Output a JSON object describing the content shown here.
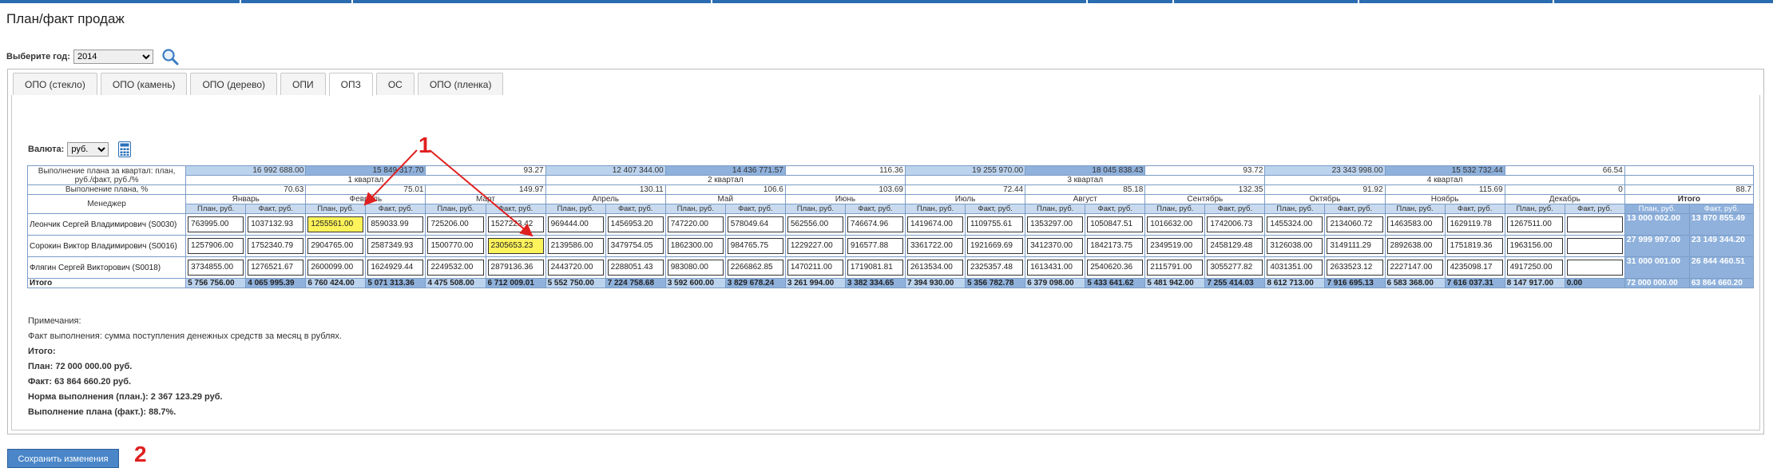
{
  "page": {
    "title": "План/факт продаж"
  },
  "filter": {
    "year_label": "Выберите год:",
    "year_value": "2014"
  },
  "tabs": [
    "ОПО (стекло)",
    "ОПО (камень)",
    "ОПО (дерево)",
    "ОПИ",
    "ОПЗ",
    "ОС",
    "ОПО (пленка)"
  ],
  "active_tab": 4,
  "currency": {
    "label": "Валюта:",
    "value": "руб."
  },
  "table": {
    "quarter_label": "Выполнение плана за квартал: план, руб./факт, руб./%",
    "quarters": [
      {
        "name": "1 квартал",
        "plan": "16 992 688.00",
        "fact": "15 849 317.70",
        "pct": "93.27"
      },
      {
        "name": "2 квартал",
        "plan": "12 407 344.00",
        "fact": "14 436 771.57",
        "pct": "116.36"
      },
      {
        "name": "3 квартал",
        "plan": "19 255 970.00",
        "fact": "18 045 838.43",
        "pct": "93.72"
      },
      {
        "name": "4 квартал",
        "plan": "23 343 998.00",
        "fact": "15 532 732.44",
        "pct": "66.54"
      }
    ],
    "pct_label": "Выполнение плана, %",
    "month_pct": [
      "70.63",
      "75.01",
      "149.97",
      "130.11",
      "106.6",
      "103.69",
      "72.44",
      "85.18",
      "132.35",
      "91.92",
      "115.69",
      "0"
    ],
    "total_pct": "88.7",
    "manager_header": "Менеджер",
    "months": [
      "Январь",
      "Февраль",
      "Март",
      "Апрель",
      "Май",
      "Июнь",
      "Июль",
      "Август",
      "Сентябрь",
      "Октябрь",
      "Ноябрь",
      "Декабрь"
    ],
    "total_header": "Итого",
    "plan_sub": "План, руб.",
    "fact_sub": "Факт, руб.",
    "rows": [
      {
        "manager": "Леончик Сергей Владимирович (S0030)",
        "cells": [
          "763995.00",
          "1037132.93",
          "1255561.00",
          "859033.99",
          "725206.00",
          "1527223.42",
          "969444.00",
          "1456953.20",
          "747220.00",
          "578049.64",
          "562556.00",
          "746674.96",
          "1419674.00",
          "1109755.61",
          "1353297.00",
          "1050847.51",
          "1016632.00",
          "1742006.73",
          "1455324.00",
          "2134060.72",
          "1463583.00",
          "1629119.78",
          "1267511.00",
          ""
        ],
        "total_plan": "13 000 002.00",
        "total_fact": "13 870 855.49"
      },
      {
        "manager": "Сорокин Виктор Владимирович (S0016)",
        "cells": [
          "1257906.00",
          "1752340.79",
          "2904765.00",
          "2587349.93",
          "1500770.00",
          "2305653.23",
          "2139586.00",
          "3479754.05",
          "1862300.00",
          "984765.75",
          "1229227.00",
          "916577.88",
          "3361722.00",
          "1921669.69",
          "3412370.00",
          "1842173.75",
          "2349519.00",
          "2458129.48",
          "3126038.00",
          "3149111.29",
          "2892638.00",
          "1751819.36",
          "1963156.00",
          ""
        ],
        "total_plan": "27 999 997.00",
        "total_fact": "23 149 344.20"
      },
      {
        "manager": "Флягин Сергей Викторович (S0018)",
        "cells": [
          "3734855.00",
          "1276521.67",
          "2600099.00",
          "1624929.44",
          "2249532.00",
          "2879136.36",
          "2443720.00",
          "2288051.43",
          "983080.00",
          "2266862.85",
          "1470211.00",
          "1719081.81",
          "2613534.00",
          "2325357.48",
          "1613431.00",
          "2540620.36",
          "2115791.00",
          "3055277.82",
          "4031351.00",
          "2633523.12",
          "2227147.00",
          "4235098.17",
          "4917250.00",
          ""
        ],
        "total_plan": "31 000 001.00",
        "total_fact": "26 844 460.51"
      }
    ],
    "highlighted": [
      [
        0,
        2
      ],
      [
        1,
        5
      ]
    ],
    "totals_label": "Итого",
    "totals": [
      "5 756 756.00",
      "4 065 995.39",
      "6 760 424.00",
      "5 071 313.36",
      "4 475 508.00",
      "6 712 009.01",
      "5 552 750.00",
      "7 224 758.68",
      "3 592 600.00",
      "3 829 678.24",
      "3 261 994.00",
      "3 382 334.65",
      "7 394 930.00",
      "5 356 782.78",
      "6 379 098.00",
      "5 433 641.62",
      "5 481 942.00",
      "7 255 414.03",
      "8 612 713.00",
      "7 916 695.13",
      "6 583 368.00",
      "7 616 037.31",
      "8 147 917.00",
      "0.00"
    ],
    "totals_plan": "72 000 000.00",
    "totals_fact": "63 864 660.20"
  },
  "notes": {
    "title": "Примечания:",
    "fact_note": "Факт выполнения: сумма поступления денежных средств за месяц в рублях.",
    "total_title": "Итого:",
    "plan": "План: 72 000 000.00 руб.",
    "fact": "Факт: 63 864 660.20 руб.",
    "norm": "Норма выполнения (план.): 2 367 123.29 руб.",
    "exec": "Выполнение плана (факт.): 88.7%."
  },
  "save_button": "Сохранить изменения",
  "annotations": {
    "marker_1": "1",
    "marker_2": "2",
    "arrow_color": "#e02020"
  },
  "icons": {
    "search": "search-icon",
    "calculator": "calculator-icon"
  }
}
